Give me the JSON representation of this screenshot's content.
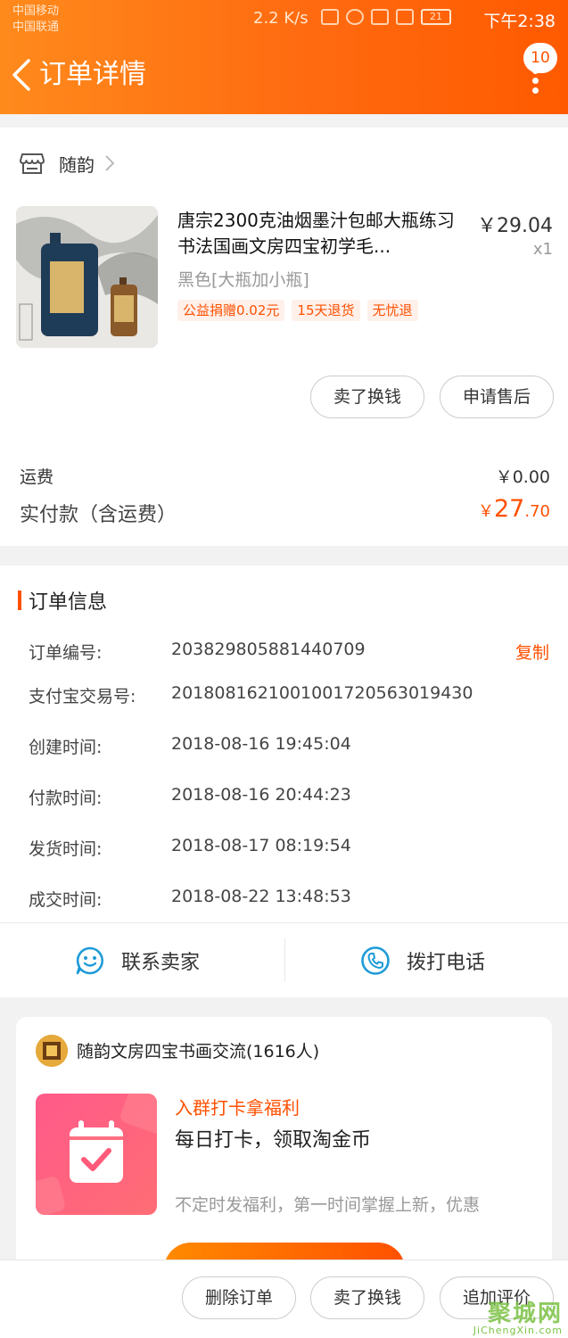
{
  "status_bar": {
    "carrier1": "中国移动",
    "carrier2": "中国联通",
    "speed": "2.2 K/s",
    "battery": "21",
    "time": "下午2:38"
  },
  "header": {
    "title": "订单详情",
    "badge": "10",
    "bg_color": "#ff6a10"
  },
  "shop": {
    "name": "随韵"
  },
  "product": {
    "title": "唐宗2300克油烟墨汁包邮大瓶练习书法国画文房四宝初学毛...",
    "price": "￥29.04",
    "qty": "x1",
    "sku": "黑色[大瓶加小瓶]",
    "tags": [
      "公益捐赠0.02元",
      "15天退货",
      "无忧退"
    ]
  },
  "product_actions": {
    "sell": "卖了换钱",
    "aftersale": "申请售后"
  },
  "summary": {
    "shipping_label": "运费",
    "shipping_value": "￥0.00",
    "paid_label": "实付款（含运费）",
    "paid_currency": "￥",
    "paid_int": "27",
    "paid_dec": ".70"
  },
  "order_info": {
    "title": "订单信息",
    "copy_label": "复制",
    "rows": [
      {
        "label": "订单编号:",
        "value": "203829805881440709"
      },
      {
        "label": "支付宝交易号:",
        "value": "2018081621001001720563019430"
      },
      {
        "label": "创建时间:",
        "value": "2018-08-16 19:45:04"
      },
      {
        "label": "付款时间:",
        "value": "2018-08-16 20:44:23"
      },
      {
        "label": "发货时间:",
        "value": "2018-08-17 08:19:54"
      },
      {
        "label": "成交时间:",
        "value": "2018-08-22 13:48:53"
      }
    ]
  },
  "contact": {
    "seller": "联系卖家",
    "phone": "拨打电话"
  },
  "group": {
    "name": "随韵文房四宝书画交流(1616人)",
    "promo_title": "入群打卡拿福利",
    "promo_sub": "每日打卡，领取淘金币",
    "promo_desc": "不定时发福利，第一时间掌握上新，优惠"
  },
  "bottom": {
    "delete": "删除订单",
    "sell": "卖了换钱",
    "review": "追加评价"
  },
  "watermark": {
    "cn": "聚城网",
    "en": "JiChengXin.com"
  },
  "colors": {
    "accent": "#ff5000",
    "watermark": "#7bc144"
  }
}
